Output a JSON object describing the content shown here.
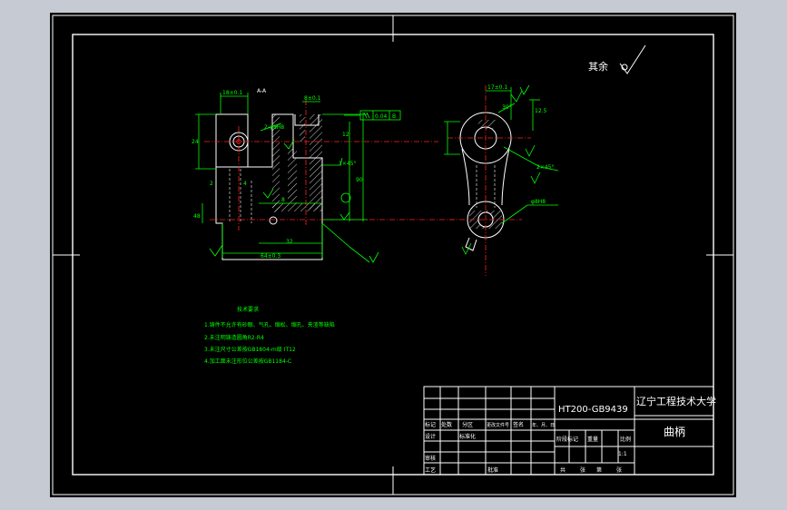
{
  "roughness": {
    "label": "其余"
  },
  "section_label": "A-A",
  "tech_requirements": {
    "title": "技术要求",
    "items": [
      "1.铸件不允许有砂眼、气孔、缩松、缩孔、夹渣等缺陷",
      "2.未注明铸造圆角R2-R4",
      "3.未注尺寸公差按GB1804-m级 IT12",
      "4.加工面未注形位公差按GB1184-C"
    ]
  },
  "dimensions": {
    "top_left_width": "18±0.1",
    "slot_width": "8±0.1",
    "hole_spec": "2-φ8H8",
    "overall_length": "64±0.3",
    "chamfer": "1×45°",
    "height_small": "12",
    "parallel_tol": "0.04",
    "parallel_datum": "B",
    "right_top": "17±0.1",
    "angle": "30°",
    "side_dim": "12.5",
    "chamfer_right": "2×45°",
    "small_hole": "φ8H8",
    "dim_left": "24",
    "dim_mid": "32",
    "dim_bottom": "48",
    "dim_4": "4",
    "dim_2": "2",
    "dim_8": "8",
    "dim_90": "90"
  },
  "title_block": {
    "material": "HT200-GB9439",
    "school": "辽宁工程技术大学",
    "part_name": "曲柄",
    "scale": "1:1",
    "row_labels": [
      "标记",
      "处数",
      "分区",
      "更改文件号",
      "签名",
      "年、月、日"
    ],
    "row2_labels": [
      "设计",
      "标准化",
      "阶段标记",
      "重量",
      "比例"
    ],
    "row3_labels": [
      "审核",
      "工艺",
      "批准"
    ],
    "sheet_text": [
      "共",
      "张",
      "第",
      "张"
    ]
  },
  "colors": {
    "background": "#000000",
    "border": "#ffffff",
    "annotation": "#00ff00",
    "centerline": "#ff2020",
    "app_frame": "#c5cad3"
  }
}
